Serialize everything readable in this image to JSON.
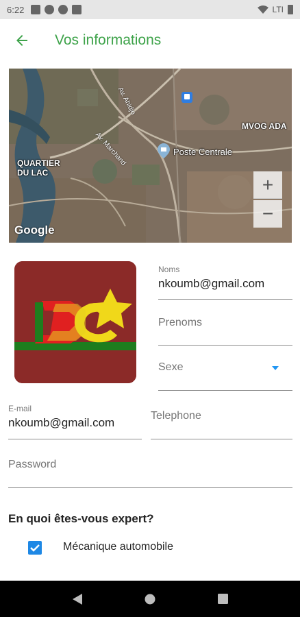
{
  "status_bar": {
    "time": "6:22",
    "network": "LTI"
  },
  "app_bar": {
    "title": "Vos informations"
  },
  "map": {
    "labels": {
      "quartier": "QUARTIER\nDU LAC",
      "mvog": "MVOG ADA",
      "poste": "Poste Centrale",
      "street1": "Av. Ahidjo",
      "street2": "Av. Marchand"
    },
    "attribution": "Google",
    "zoom_in": "+",
    "zoom_out": "−"
  },
  "form": {
    "noms": {
      "label": "Noms",
      "value": "nkoumb@gmail.com"
    },
    "prenoms": {
      "placeholder": "Prenoms"
    },
    "sexe": {
      "placeholder": "Sexe"
    },
    "email": {
      "label": "E-mail",
      "value": "nkoumb@gmail.com"
    },
    "telephone": {
      "placeholder": "Telephone"
    },
    "password": {
      "placeholder": "Password"
    }
  },
  "expertise": {
    "title": "En quoi êtes-vous expert?",
    "options": [
      {
        "label": "Mécanique automobile",
        "checked": true
      }
    ]
  },
  "colors": {
    "accent": "#3ea34a",
    "checkbox": "#1e88e5",
    "avatar_bg": "#8b2a28"
  },
  "icons": [
    "back-arrow-icon",
    "dropdown-arrow-icon",
    "checkbox-check-icon",
    "nav-back-icon",
    "nav-home-icon",
    "nav-recents-icon"
  ]
}
